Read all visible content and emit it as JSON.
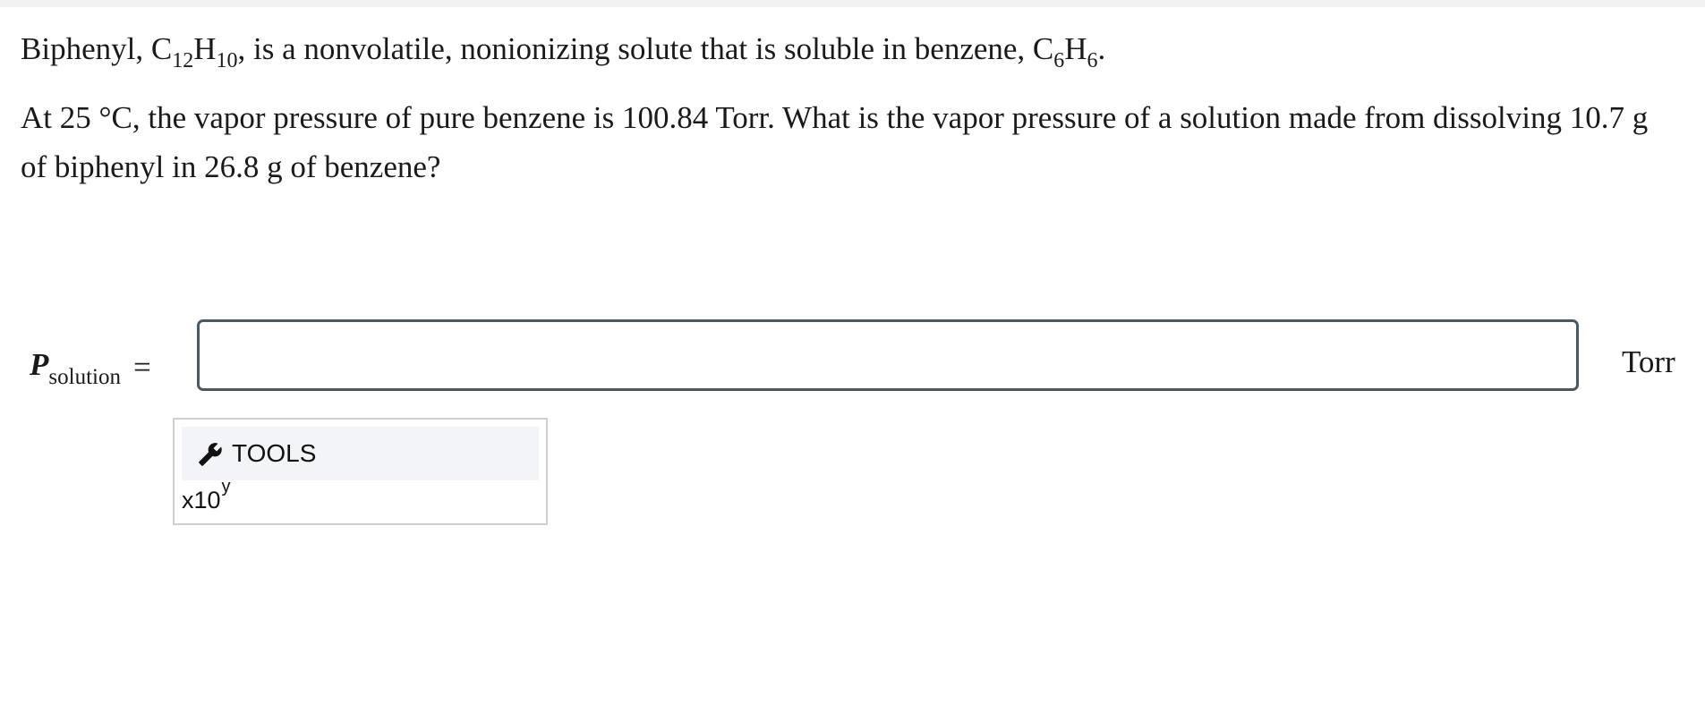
{
  "question": {
    "line1": {
      "prefix": "Biphenyl, C",
      "sub1": "12",
      "mid1": "H",
      "sub2": "10",
      "mid2": ", is a nonvolatile, nonionizing solute that is soluble in benzene, C",
      "sub3": "6",
      "mid3": "H",
      "sub4": "6",
      "end": "."
    },
    "paragraph2": "At 25 °C, the vapor pressure of pure benzene is 100.84 Torr. What is the vapor pressure of a solution made from dissolving 10.7 g of biphenyl in 26.8 g of benzene?"
  },
  "answer": {
    "label_main": "P",
    "label_sub": "solution",
    "equals": "=",
    "value": "",
    "unit": "Torr"
  },
  "tools": {
    "icon": "wrench-icon",
    "header_label": "TOOLS",
    "sci_base": "x10",
    "sci_exp": "y"
  },
  "colors": {
    "input_border": "#4a5866",
    "tools_header_bg": "#f3f4f7",
    "tools_border": "#cfcfcf"
  }
}
